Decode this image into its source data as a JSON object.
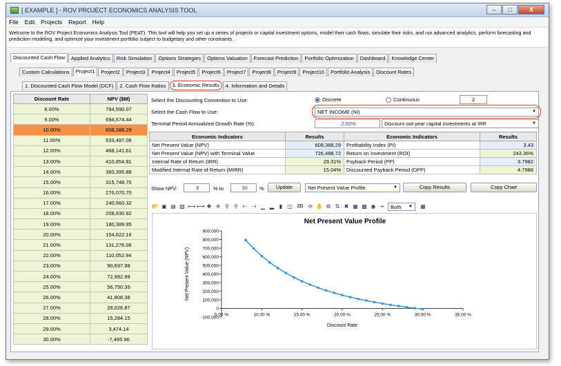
{
  "window": {
    "title": "[ EXAMPLE ] - ROV PROJECT ECONOMICS ANALYSIS TOOL",
    "minimize": "–",
    "maximize": "□",
    "close": "X"
  },
  "menu": [
    "File",
    "Edit",
    "Projects",
    "Report",
    "Help"
  ],
  "welcome": "Welcome to the ROV Project Economics Analysis Tool (PEAT). This tool will help you set up a series of projects or capital investment options, model their cash flows, simulate their risks, and run advanced analytics, perform forecasting and prediction modeling, and optimize your investment portfolio subject to budgetary and other constraints.",
  "main_tabs": [
    "Discounted Cash Flow",
    "Applied Analytics",
    "Risk Simulation",
    "Options Strategies",
    "Options Valuation",
    "Forecast Prediction",
    "Portfolio Optimization",
    "Dashboard",
    "Knowledge Center"
  ],
  "project_tabs": [
    "Custom Calculations",
    "Project1",
    "Project2",
    "Project3",
    "Project4",
    "Project5",
    "Project6",
    "Project7",
    "Project8",
    "Project9",
    "Project10",
    "Portfolio Analysis",
    "Discount Rates"
  ],
  "sub_tabs": [
    "1. Discounted Cash Flow Model (DCF)",
    "2. Cash Flow Ratios",
    "3. Economic Results",
    "4. Information and Details"
  ],
  "npv_table": {
    "headers": [
      "Discount Rate",
      "NPV ($M)"
    ],
    "rows": [
      [
        "8.00%",
        "794,590.07"
      ],
      [
        "9.00%",
        "694,674.44"
      ],
      [
        "10.00%",
        "608,388.29"
      ],
      [
        "11.00%",
        "533,487.06"
      ],
      [
        "12.00%",
        "468,141.61"
      ],
      [
        "13.00%",
        "410,854.81"
      ],
      [
        "14.00%",
        "360,395.88"
      ],
      [
        "15.00%",
        "315,748.70"
      ],
      [
        "16.00%",
        "276,070.70"
      ],
      [
        "17.00%",
        "240,660.32"
      ],
      [
        "18.00%",
        "208,930.92"
      ],
      [
        "19.00%",
        "180,389.95"
      ],
      [
        "20.00%",
        "154,622.16"
      ],
      [
        "21.00%",
        "131,276.06"
      ],
      [
        "22.00%",
        "110,052.94"
      ],
      [
        "23.00%",
        "90,697.98"
      ],
      [
        "24.00%",
        "72,992.99"
      ],
      [
        "25.00%",
        "56,750.39"
      ],
      [
        "26.00%",
        "41,808.38"
      ],
      [
        "27.00%",
        "28,026.87"
      ],
      [
        "28.00%",
        "15,284.15"
      ],
      [
        "29.00%",
        "3,474.14"
      ],
      [
        "30.00%",
        "-7,495.96"
      ]
    ],
    "highlight_row": 2
  },
  "settings": {
    "convention_label": "Select the Discounting Convention to Use:",
    "discrete": "Discrete",
    "continuous": "Continuous",
    "periods": "2",
    "cashflow_label": "Select the Cash Flow to Use:",
    "cashflow_value": "NET INCOME (NI)",
    "growth_label": "Terminal Period Annualized Growth Rate (%):",
    "growth_value": "2.00%",
    "discount_option": "Discount out-year capital investments at IRR"
  },
  "econ": {
    "headers": [
      "Economic Indicators",
      "Results",
      "Economic Indicators",
      "Results"
    ],
    "left": [
      [
        "Net Present Value (NPV)",
        "608,388.29"
      ],
      [
        "Net Present Value (NPV) with Terminal Value",
        "726,488.72"
      ],
      [
        "Internal Rate of Return (IRR)",
        "29.31%"
      ],
      [
        "Modified Internal Rate of Return (MIRR)",
        "15.04%"
      ]
    ],
    "right": [
      [
        "Profitability Index (PI)",
        "3.43"
      ],
      [
        "Return on Investment (ROI)",
        "243.36%"
      ],
      [
        "Payback Period (PP)",
        "3.7982"
      ],
      [
        "Discounted Payback Period (DPP)",
        "4.7988"
      ]
    ]
  },
  "npv_controls": {
    "label": "Show NPV:",
    "from": "8",
    "to_label": "% to",
    "to": "30",
    "pct": "%",
    "update": "Update",
    "chart_select": "Net Present Value Profile",
    "copy_results": "Copy Results",
    "copy_chart": "Copy Chart"
  },
  "toolbar": {
    "two_d": "2D",
    "both": "Both"
  },
  "chart_data": {
    "type": "line",
    "title": "Net Present Value Profile",
    "xlabel": "Discount Rate",
    "ylabel": "Net Present Value (NPV)",
    "x": [
      8,
      9,
      10,
      11,
      12,
      13,
      14,
      15,
      16,
      17,
      18,
      19,
      20,
      21,
      22,
      23,
      24,
      25,
      26,
      27,
      28,
      29,
      30
    ],
    "y": [
      794590.07,
      694674.44,
      608388.29,
      533487.06,
      468141.61,
      410854.81,
      360395.88,
      315748.7,
      276070.7,
      240660.32,
      208930.92,
      180389.95,
      154622.16,
      131276.06,
      110052.94,
      90697.98,
      72992.99,
      56750.39,
      41808.38,
      28026.87,
      15284.15,
      3474.14,
      -7495.96
    ],
    "xticks": [
      "5.00 %",
      "10.00 %",
      "15.00 %",
      "20.00 %",
      "25.00 %",
      "30.00 %",
      "35.00 %"
    ],
    "yticks": [
      "900,000",
      "800,000",
      "700,000",
      "600,000",
      "500,000",
      "400,000",
      "300,000",
      "200,000",
      "100,000",
      "0",
      "-100,000"
    ],
    "xlim": [
      5,
      35
    ],
    "ylim": [
      -100000,
      900000
    ],
    "color": "#3a8fd6"
  }
}
